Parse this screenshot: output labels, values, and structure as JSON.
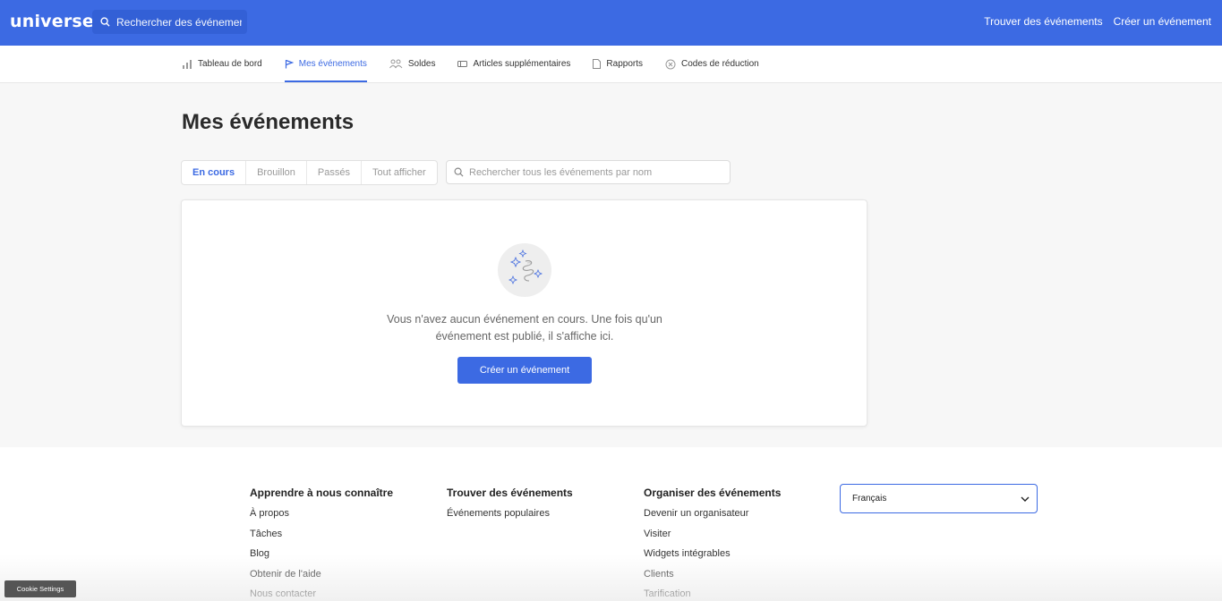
{
  "app": {
    "logo": "universe",
    "search_placeholder": "Rechercher des événements",
    "top_links": [
      "Trouver des événements",
      "Créer un événement"
    ]
  },
  "subnav": {
    "items": [
      {
        "label": "Tableau de bord",
        "icon": "bar-chart-icon",
        "active": false
      },
      {
        "label": "Mes événements",
        "icon": "flag-icon",
        "active": true
      },
      {
        "label": "Soldes",
        "icon": "people-icon",
        "active": false
      },
      {
        "label": "Articles supplémentaires",
        "icon": "ticket-icon",
        "active": false
      },
      {
        "label": "Rapports",
        "icon": "document-icon",
        "active": false
      },
      {
        "label": "Codes de réduction",
        "icon": "discount-icon",
        "active": false
      }
    ]
  },
  "main": {
    "title": "Mes événements",
    "tabs": [
      "En cours",
      "Brouillon",
      "Passés",
      "Tout afficher"
    ],
    "active_tab": "En cours",
    "search_placeholder": "Rechercher tous les événements par nom",
    "empty_line1": "Vous n'avez aucun événement en cours. Une fois qu'un",
    "empty_line2": "événement est publié, il s'affiche ici.",
    "cta_label": "Créer un événement"
  },
  "footer": {
    "columns": [
      {
        "heading": "Apprendre à nous connaître",
        "links": [
          "À propos",
          "Tâches",
          "Blog",
          "Obtenir de l'aide",
          "Nous contacter"
        ]
      },
      {
        "heading": "Trouver des événements",
        "links": [
          "Événements populaires"
        ]
      },
      {
        "heading": "Organiser des événements",
        "links": [
          "Devenir un organisateur",
          "Visiter",
          "Widgets intégrables",
          "Clients",
          "Tarification"
        ]
      }
    ],
    "language": "Français"
  },
  "cookie_button": "Cookie Settings",
  "colors": {
    "brand": "#3c6ae3",
    "background": "#f7f7f7"
  }
}
